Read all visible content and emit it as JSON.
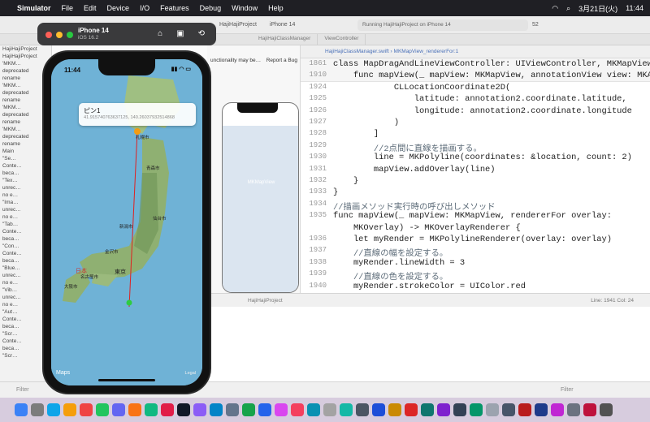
{
  "menubar": {
    "app": "Simulator",
    "items": [
      "File",
      "Edit",
      "Device",
      "I/O",
      "Features",
      "Debug",
      "Window",
      "Help"
    ],
    "date": "3月21日(火)",
    "time": "11:44"
  },
  "xcode": {
    "tabs": [
      "HajiHajiProject",
      "iPhone 14",
      "Running HajiHajiProject on iPhone 14",
      "52"
    ],
    "status": "Running HajiHajiProject on iPhone 14",
    "tabbar": [
      "HajiHajiClassManager",
      "ViewController"
    ],
    "navigator": [
      "HajiHajiProject",
      "HajiHajiProject",
      "'MKM…",
      "deprecated",
      "rename",
      "'MKM…",
      "deprecated",
      "rename",
      "'MKM…",
      "deprecated",
      "rename",
      "'MKM…",
      "deprecated",
      "rename",
      "Main",
      "\"Se…",
      "Conte…",
      "beca…",
      "\"Tex…",
      "unrec…",
      "no e…",
      "\"Ima…",
      "unrec…",
      "no e…",
      "\"Tab…",
      "Conte…",
      "beca…",
      "\"Con…",
      "Conte…",
      "beca…",
      "\"Blue…",
      "unrec…",
      "no e…",
      "\"Vib…",
      "unrec…",
      "no e…",
      "\"Aut…",
      "Conte…",
      "beca…",
      "\"Scr…",
      "Conte…",
      "beca…",
      "\"Scr…"
    ],
    "warning": "unctionality may be…",
    "report_bug": "Report a Bug",
    "canvas_view": "MKMapView",
    "editor_path": "HajiHajiClassManager.swift  ›  MKMapView_rendererFor:1",
    "linecol": "Line: 1941  Col: 24",
    "crumb": "HajiHajiProject",
    "filter": "Filter",
    "filter2": "Filter"
  },
  "code_lines": [
    {
      "n": "1861",
      "t": "class MapDragAndLineViewController: UIViewController, MKMapViewDe…"
    },
    {
      "n": "1910",
      "t": "    func mapView(_ mapView: MKMapView, annotationView view: MKAnn…"
    },
    {
      "n": "1924",
      "t": "            CLLocationCoordinate2D("
    },
    {
      "n": "1925",
      "t": "                latitude: annotation2.coordinate.latitude,"
    },
    {
      "n": "1926",
      "t": "                longitude: annotation2.coordinate.longitude"
    },
    {
      "n": "1927",
      "t": "            )"
    },
    {
      "n": "1928",
      "t": "        ]"
    },
    {
      "n": "1929",
      "t": "        //2点間に直線を描画する。"
    },
    {
      "n": "1930",
      "t": "        line = MKPolyline(coordinates: &location, count: 2)"
    },
    {
      "n": "1931",
      "t": "        mapView.addOverlay(line)"
    },
    {
      "n": "1932",
      "t": "    }"
    },
    {
      "n": "1933",
      "t": "}"
    },
    {
      "n": "1934",
      "t": "//描画メソッド実行時の呼び出しメソッド"
    },
    {
      "n": "1935",
      "t": "func mapView(_ mapView: MKMapView, rendererFor overlay:"
    },
    {
      "n": "",
      "t": "    MKOverlay) -> MKOverlayRenderer {"
    },
    {
      "n": "1936",
      "t": "    let myRender = MKPolylineRenderer(overlay: overlay)"
    },
    {
      "n": "1937",
      "t": "    //直線の幅を設定する。"
    },
    {
      "n": "1938",
      "t": "    myRender.lineWidth = 3"
    },
    {
      "n": "1939",
      "t": "    //直線の色を設定する。"
    },
    {
      "n": "1940",
      "t": "    myRender.strokeColor = UIColor.red"
    }
  ],
  "simulator": {
    "title": "iPhone 14",
    "subtitle": "iOS 16.2",
    "time": "11:44"
  },
  "callout": {
    "title": "ピン1",
    "coords": "41.915740763637125, 140.26037932514868"
  },
  "map": {
    "logo": "Maps",
    "legal": "Legal",
    "labels": [
      "青森市",
      "仙台市",
      "新潟市",
      "金沢市",
      "名古屋市",
      "大阪市",
      "東京",
      "日本",
      "札幌市"
    ]
  },
  "colors": {
    "line": "#e02020",
    "pin_start": "#f39c12",
    "pin_end": "#2ecc40"
  }
}
